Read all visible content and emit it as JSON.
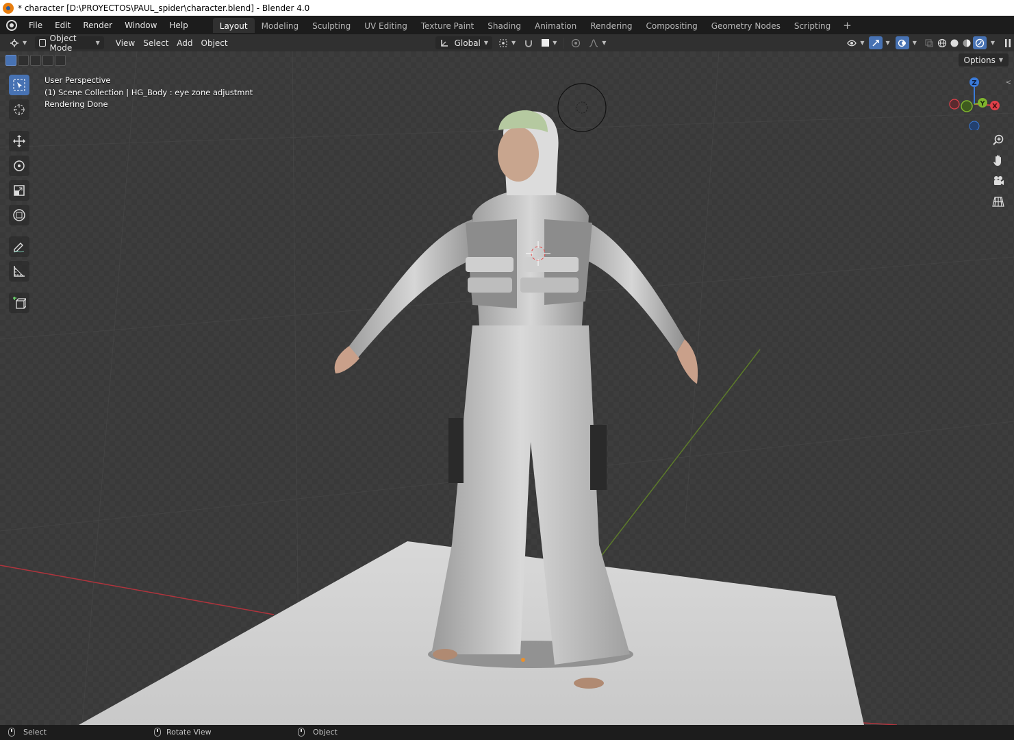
{
  "window": {
    "title": "* character [D:\\PROYECTOS\\PAUL_spider\\character.blend] - Blender 4.0"
  },
  "menu": {
    "items": [
      "File",
      "Edit",
      "Render",
      "Window",
      "Help"
    ]
  },
  "workspaces": {
    "tabs": [
      "Layout",
      "Modeling",
      "Sculpting",
      "UV Editing",
      "Texture Paint",
      "Shading",
      "Animation",
      "Rendering",
      "Compositing",
      "Geometry Nodes",
      "Scripting"
    ],
    "active": "Layout"
  },
  "header": {
    "mode": "Object Mode",
    "menus": [
      "View",
      "Select",
      "Add",
      "Object"
    ],
    "transform_orientation": "Global"
  },
  "viewport": {
    "view_name": "User Perspective",
    "collection_info": "(1) Scene Collection | HG_Body : eye zone adjustmnt",
    "status": "Rendering Done",
    "options_label": "Options"
  },
  "gizmo": {
    "x": "X",
    "y": "Y",
    "z": "Z"
  },
  "tools": [
    "select-box",
    "cursor",
    "move",
    "rotate",
    "scale",
    "transform",
    "annotate",
    "measure",
    "add-cube"
  ],
  "statusbar": {
    "left": "Select",
    "middle": "Rotate View",
    "right": "Object"
  },
  "colors": {
    "accent": "#4772b3",
    "x_axis": "#e0404a",
    "y_axis": "#7fb52e",
    "z_axis": "#3a7ad8"
  }
}
